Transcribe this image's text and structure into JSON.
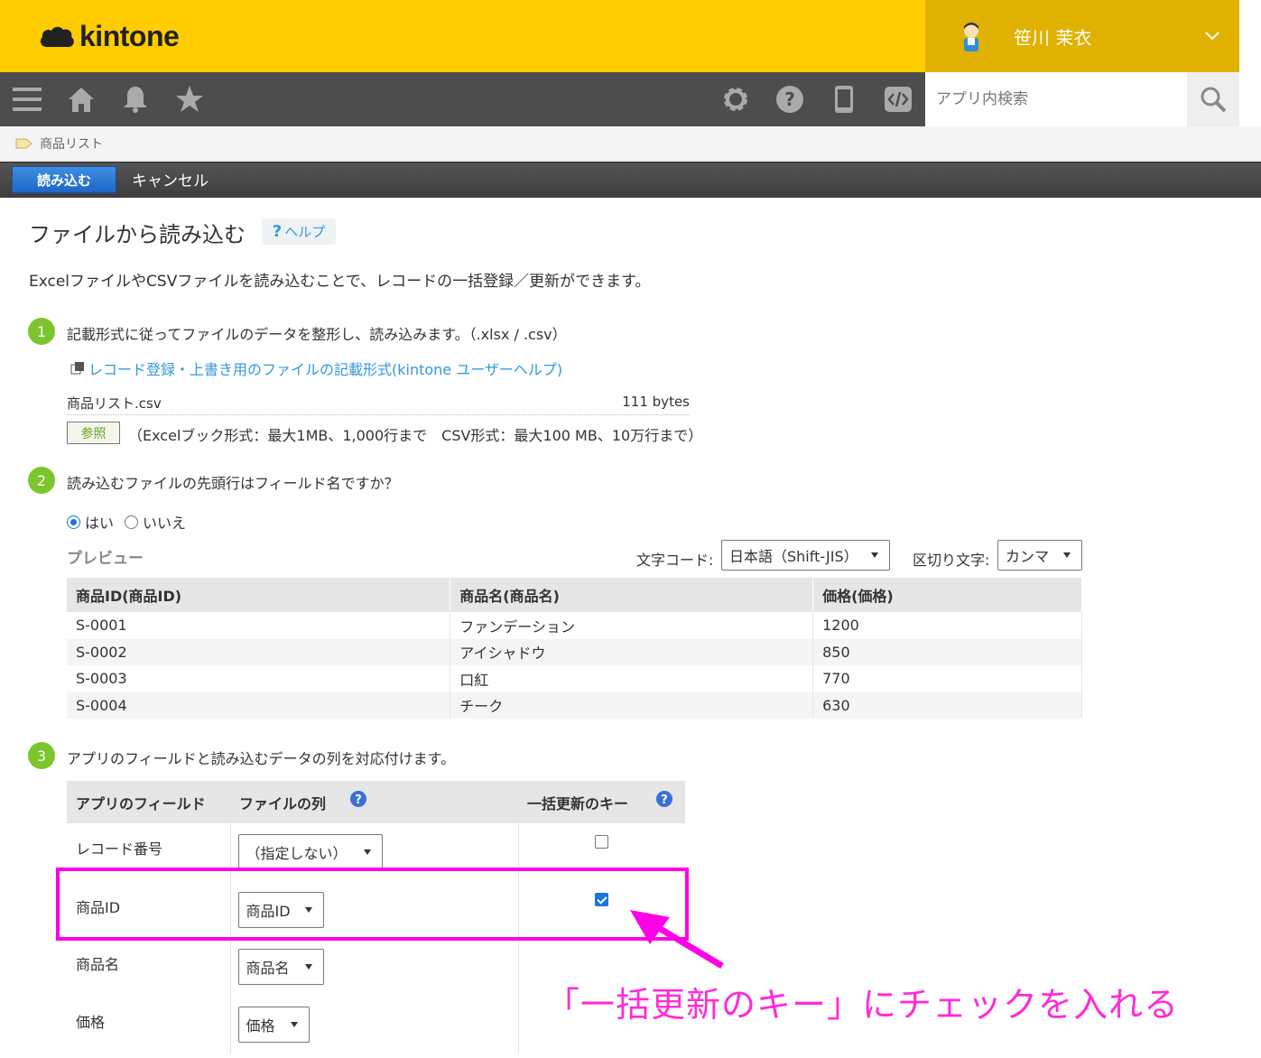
{
  "header": {
    "logo_text": "kintone",
    "user_name": "笹川 茉衣",
    "brand_color": "#ffcc00"
  },
  "nav": {
    "icons": [
      "menu-icon",
      "home-icon",
      "bell-icon",
      "star-icon",
      "gear-icon",
      "help-icon",
      "mobile-icon",
      "code-icon"
    ],
    "search_placeholder": "アプリ内検索"
  },
  "breadcrumb": {
    "app_name": "商品リスト"
  },
  "actions": {
    "import_label": "読み込む",
    "cancel_label": "キャンセル"
  },
  "page": {
    "title": "ファイルから読み込む",
    "help_label": "ヘルプ",
    "intro": "ExcelファイルやCSVファイルを読み込むことで、レコードの一括登録／更新ができます。"
  },
  "step1": {
    "num": "1",
    "text": "記載形式に従ってファイルのデータを整形し、読み込みます。（.xlsx / .csv）",
    "doc_link": "レコード登録・上書き用のファイルの記載形式(kintone ユーザーヘルプ)",
    "file_name": "商品リスト.csv",
    "file_size": "111 bytes",
    "browse_label": "参照",
    "browse_note": "（Excelブック形式：最大1MB、1,000行まで　CSV形式：最大100 MB、10万行まで）"
  },
  "step2": {
    "num": "2",
    "text": "読み込むファイルの先頭行はフィールド名ですか？",
    "yes_label": "はい",
    "no_label": "いいえ",
    "preview_label": "プレビュー",
    "encoding_label": "文字コード:",
    "encoding_value": "日本語（Shift-JIS）",
    "delimiter_label": "区切り文字:",
    "delimiter_value": "カンマ",
    "table": {
      "headers": [
        "商品ID(商品ID)",
        "商品名(商品名)",
        "価格(価格)"
      ],
      "rows": [
        [
          "S-0001",
          "ファンデーション",
          "1200"
        ],
        [
          "S-0002",
          "アイシャドウ",
          "850"
        ],
        [
          "S-0003",
          "口紅",
          "770"
        ],
        [
          "S-0004",
          "チーク",
          "630"
        ]
      ]
    }
  },
  "step3": {
    "num": "3",
    "text": "アプリのフィールドと読み込むデータの列を対応付けます。",
    "headers": [
      "アプリのフィールド",
      "ファイルの列",
      "一括更新のキー"
    ],
    "rows": [
      {
        "field": "レコード番号",
        "column": "（指定しない）",
        "key_checked": false
      },
      {
        "field": "商品ID",
        "column": "商品ID",
        "key_checked": true
      },
      {
        "field": "商品名",
        "column": "商品名"
      },
      {
        "field": "価格",
        "column": "価格"
      }
    ]
  },
  "annotation": {
    "text": "「一括更新のキー」にチェックを入れる",
    "color": "#ff00e6"
  }
}
